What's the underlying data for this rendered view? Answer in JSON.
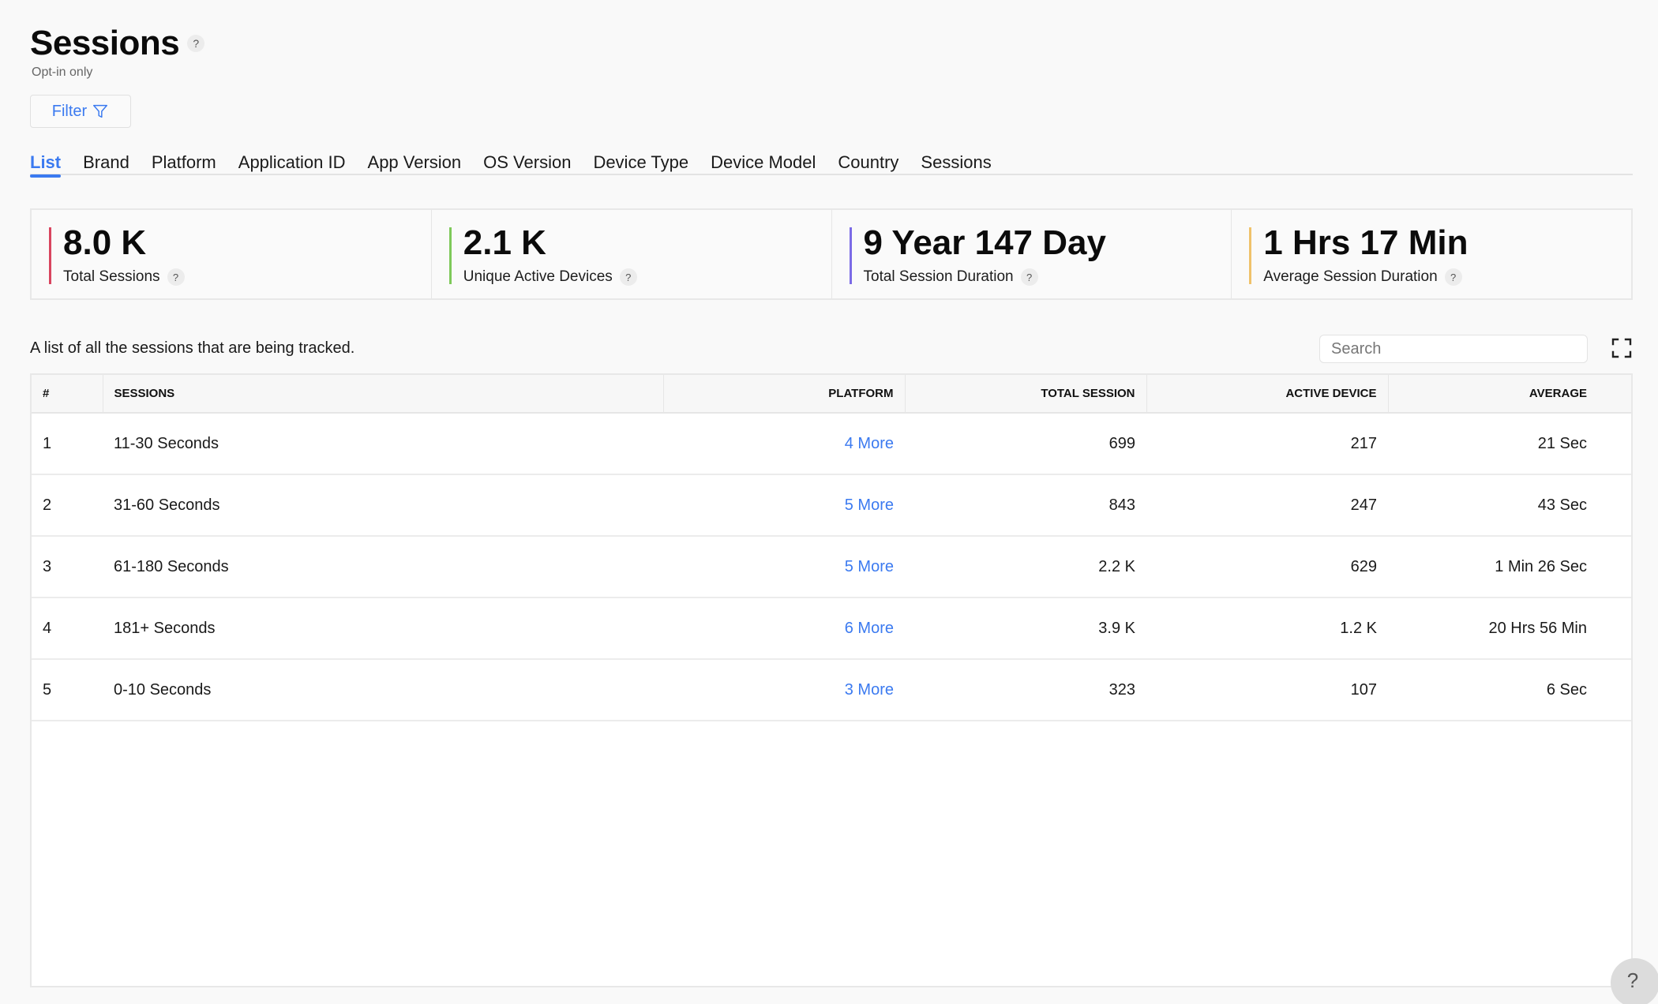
{
  "header": {
    "title": "Sessions",
    "title_help": "?",
    "subtitle": "Opt-in only",
    "filter_label": "Filter"
  },
  "tabs": [
    {
      "label": "List",
      "active": true
    },
    {
      "label": "Brand"
    },
    {
      "label": "Platform"
    },
    {
      "label": "Application ID"
    },
    {
      "label": "App Version"
    },
    {
      "label": "OS Version"
    },
    {
      "label": "Device Type"
    },
    {
      "label": "Device Model"
    },
    {
      "label": "Country"
    },
    {
      "label": "Sessions"
    }
  ],
  "kpis": [
    {
      "value": "8.0 K",
      "label": "Total Sessions",
      "help": "?",
      "color": "#d9455f"
    },
    {
      "value": "2.1 K",
      "label": "Unique Active Devices",
      "help": "?",
      "color": "#7ec95a"
    },
    {
      "value": "9 Year 147 Day",
      "label": "Total Session Duration",
      "help": "?",
      "color": "#7b6be6"
    },
    {
      "value": "1 Hrs 17 Min",
      "label": "Average Session Duration",
      "help": "?",
      "color": "#f0c26a"
    }
  ],
  "list": {
    "description": "A list of all the sessions that are being tracked.",
    "search_placeholder": "Search",
    "columns": {
      "index": "#",
      "sessions": "Sessions",
      "platform": "Platform",
      "total_session": "Total Session",
      "active_device": "Active Device",
      "average": "Average"
    },
    "rows": [
      {
        "index": "1",
        "sessions": "11-30 Seconds",
        "platform": "4 More",
        "total_session": "699",
        "active_device": "217",
        "average": "21 Sec"
      },
      {
        "index": "2",
        "sessions": "31-60 Seconds",
        "platform": "5 More",
        "total_session": "843",
        "active_device": "247",
        "average": "43 Sec"
      },
      {
        "index": "3",
        "sessions": "61-180 Seconds",
        "platform": "5 More",
        "total_session": "2.2 K",
        "active_device": "629",
        "average": "1 Min 26 Sec"
      },
      {
        "index": "4",
        "sessions": "181+ Seconds",
        "platform": "6 More",
        "total_session": "3.9 K",
        "active_device": "1.2 K",
        "average": "20 Hrs 56 Min"
      },
      {
        "index": "5",
        "sessions": "0-10 Seconds",
        "platform": "3 More",
        "total_session": "323",
        "active_device": "107",
        "average": "6 Sec"
      }
    ]
  },
  "help_fab": "?",
  "colors": {
    "accent": "#3b7af0"
  }
}
